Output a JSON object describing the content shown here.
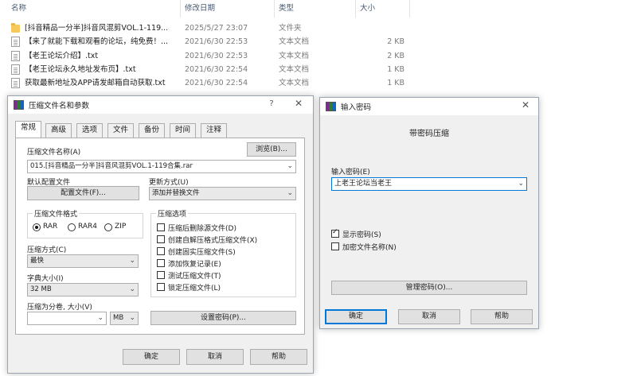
{
  "explorer": {
    "columns": {
      "name": "名称",
      "date": "修改日期",
      "type": "类型",
      "size": "大小"
    },
    "files": [
      {
        "kind": "folder",
        "name": "[抖音精品一分半]抖音风混剪VOL.1-119...",
        "date": "2025/5/27 23:07",
        "type": "文件夹",
        "size": ""
      },
      {
        "kind": "doc",
        "name": "【来了就能下载和观看的论坛，纯免费！...",
        "date": "2021/6/30 22:53",
        "type": "文本文档",
        "size": "2 KB"
      },
      {
        "kind": "doc",
        "name": "【老王论坛介绍】.txt",
        "date": "2021/6/30 22:53",
        "type": "文本文档",
        "size": "2 KB"
      },
      {
        "kind": "doc",
        "name": "【老王论坛永久地址发布页】.txt",
        "date": "2021/6/30 22:54",
        "type": "文本文档",
        "size": "1 KB"
      },
      {
        "kind": "doc",
        "name": "获取最新地址及APP请发邮箱自动获取.txt",
        "date": "2021/6/30 22:54",
        "type": "文本文档",
        "size": "1 KB"
      }
    ]
  },
  "archive_dialog": {
    "title": "压缩文件名和参数",
    "help_glyph": "?",
    "close_glyph": "✕",
    "tabs": [
      "常规",
      "高级",
      "选项",
      "文件",
      "备份",
      "时间",
      "注释"
    ],
    "archive_name_label": "压缩文件名称(A)",
    "browse_label": "浏览(B)...",
    "archive_name_value": "015.[抖音精品一分半]抖音风混剪VOL.1-119合集.rar",
    "default_profile_label": "默认配置文件",
    "profiles_button": "配置文件(F)...",
    "update_mode_label": "更新方式(U)",
    "update_mode_value": "添加并替换文件",
    "format_group": "压缩文件格式",
    "formats": [
      "RAR",
      "RAR4",
      "ZIP"
    ],
    "selected_format": "RAR",
    "options_group": "压缩选项",
    "options": [
      {
        "label": "压缩后删除源文件(D)",
        "checked": false
      },
      {
        "label": "创建自解压格式压缩文件(X)",
        "checked": false
      },
      {
        "label": "创建固实压缩文件(S)",
        "checked": false
      },
      {
        "label": "添加恢复记录(E)",
        "checked": false
      },
      {
        "label": "测试压缩文件(T)",
        "checked": false
      },
      {
        "label": "锁定压缩文件(L)",
        "checked": false
      }
    ],
    "method_label": "压缩方式(C)",
    "method_value": "最快",
    "dict_label": "字典大小(I)",
    "dict_value": "32 MB",
    "split_label": "压缩为分卷, 大小(V)",
    "split_value": "",
    "split_unit": "MB",
    "set_password_button": "设置密码(P)...",
    "ok": "确定",
    "cancel": "取消",
    "help": "帮助"
  },
  "password_dialog": {
    "title": "输入密码",
    "close_glyph": "✕",
    "heading": "带密码压缩",
    "password_label": "输入密码(E)",
    "password_value": "上老王论坛当老王",
    "show_password_label": "显示密码(S)",
    "show_password_checked": true,
    "encrypt_names_label": "加密文件名称(N)",
    "encrypt_names_checked": false,
    "organize_button": "管理密码(O)...",
    "ok": "确定",
    "cancel": "取消",
    "help": "帮助"
  }
}
